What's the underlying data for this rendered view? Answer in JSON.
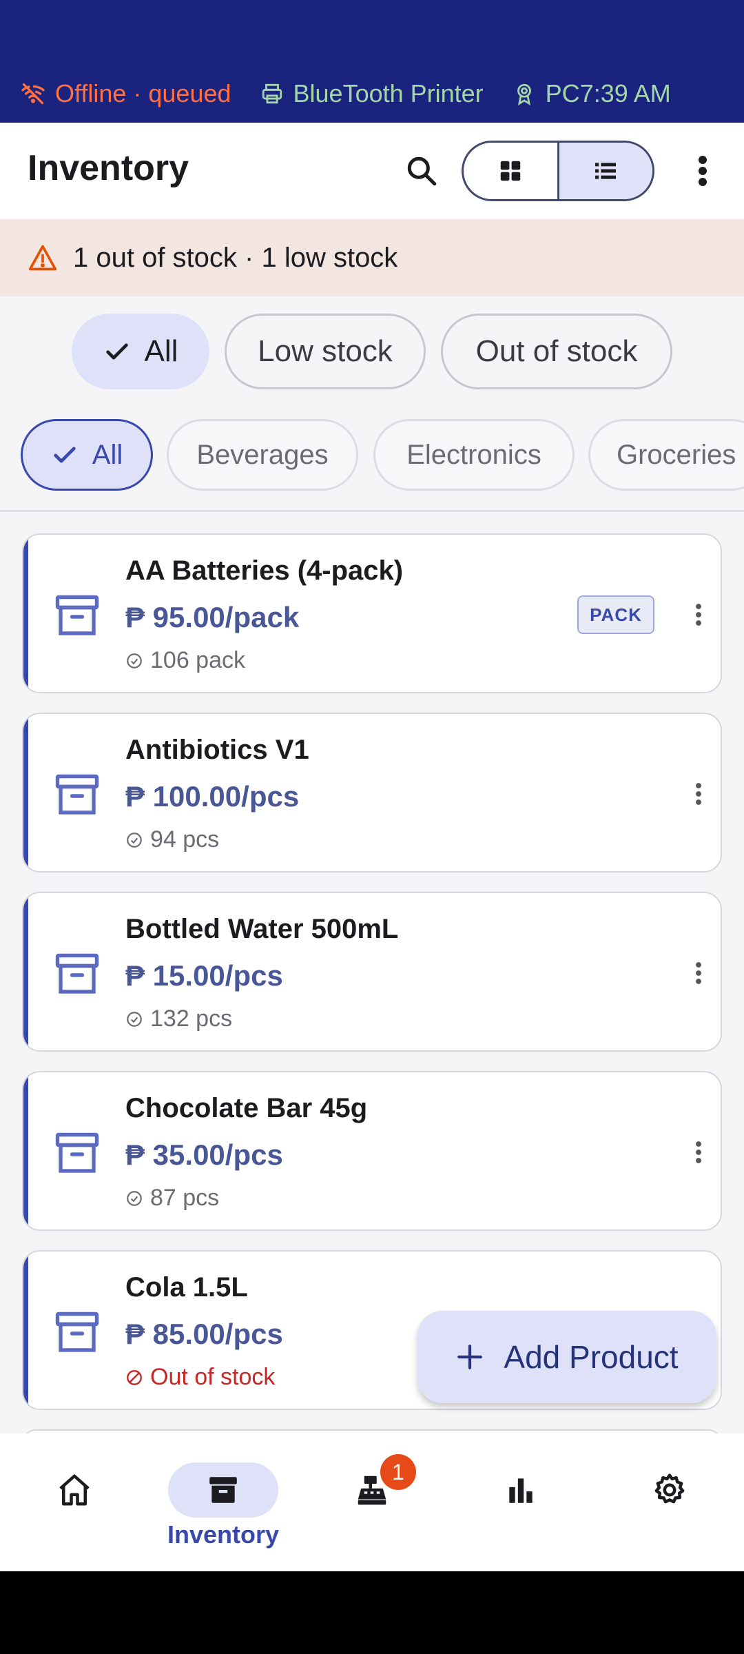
{
  "status_bar": {
    "network": "Offline · queued",
    "printer": "BlueTooth Printer",
    "pc": "PC",
    "time": "7:39 AM"
  },
  "app_bar": {
    "title": "Inventory",
    "icons": [
      "search-icon",
      "grid-view-icon",
      "list-view-icon",
      "more-vert-icon"
    ],
    "selected_view": "list"
  },
  "alert": {
    "text": "1 out of stock · 1 low stock",
    "color": "#e65100"
  },
  "stock_filters": [
    {
      "label": "All",
      "selected": true
    },
    {
      "label": "Low stock",
      "selected": false
    },
    {
      "label": "Out of stock",
      "selected": false
    }
  ],
  "category_filters": [
    {
      "label": "All",
      "selected": true
    },
    {
      "label": "Beverages",
      "selected": false
    },
    {
      "label": "Electronics",
      "selected": false
    },
    {
      "label": "Groceries",
      "selected": false
    }
  ],
  "products": [
    {
      "name": "AA Batteries (4-pack)",
      "price": "₱ 95.00/pack",
      "stock": "106 pack",
      "status": "in",
      "badge": "PACK"
    },
    {
      "name": "Antibiotics V1",
      "price": "₱ 100.00/pcs",
      "stock": "94 pcs",
      "status": "in"
    },
    {
      "name": "Bottled Water 500mL",
      "price": "₱ 15.00/pcs",
      "stock": "132 pcs",
      "status": "in"
    },
    {
      "name": "Chocolate Bar 45g",
      "price": "₱ 35.00/pcs",
      "stock": "87 pcs",
      "status": "in"
    },
    {
      "name": "Cola 1.5L",
      "price": "₱ 85.00/pcs",
      "stock": "Out of stock",
      "status": "out"
    }
  ],
  "fab": {
    "label": "Add Product"
  },
  "bottom_nav": {
    "items": [
      "home-icon",
      "inventory-icon",
      "register-icon",
      "reports-icon",
      "settings-icon"
    ],
    "active_label": "Inventory",
    "register_badge": "1"
  },
  "colors": {
    "primary": "#3949ab",
    "status_bar": "#1a237e",
    "selected_container": "#dfe1f9",
    "out_of_stock": "#c62828"
  }
}
